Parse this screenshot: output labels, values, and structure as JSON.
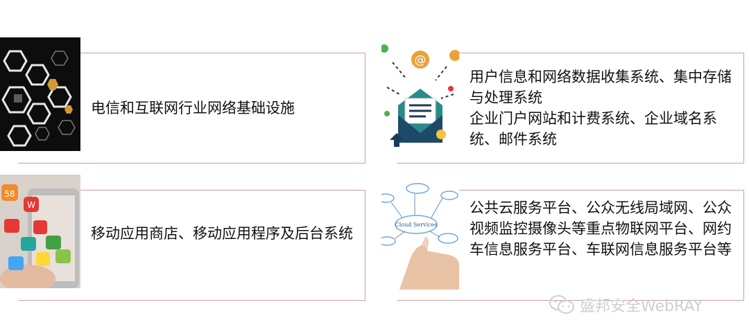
{
  "cards": [
    {
      "text": "电信和互联网行业网络基础设施",
      "icon": "hexagon-network-icon"
    },
    {
      "text": "用户信息和网络数据收集系统、集中存储与处理系统\n企业门户网站和计费系统、企业域名系统、邮件系统",
      "icon": "email-envelope-icon"
    },
    {
      "text": "移动应用商店、移动应用程序及后台系统",
      "icon": "mobile-apps-icon"
    },
    {
      "text": "公共云服务平台、公众无线局域网、公众视频监控摄像头等重点物联网平台、网约车信息服务平台、车联网信息服务平台等",
      "icon": "cloud-services-icon"
    }
  ],
  "watermark": {
    "text": "盛邦安全WebRAY",
    "icon": "wechat-icon"
  },
  "colors": {
    "card_border": "#c9a0a0",
    "text": "#111111",
    "watermark": "#cfcfcf"
  }
}
